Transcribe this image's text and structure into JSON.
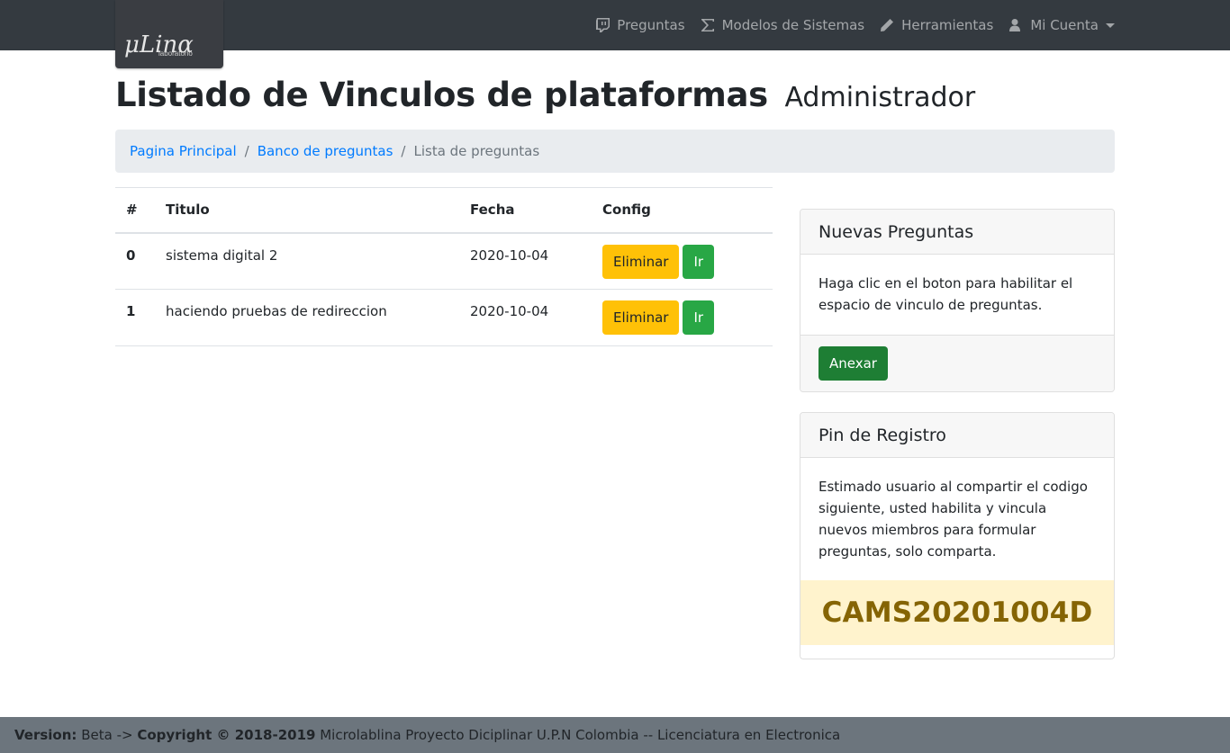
{
  "app": {
    "logo_text": "μLinα",
    "logo_subtext": "laboratorio"
  },
  "nav": {
    "items": [
      {
        "label": "Preguntas",
        "icon": "twitch-icon"
      },
      {
        "label": "Modelos de Sistemas",
        "icon": "sigma-icon"
      },
      {
        "label": "Herramientas",
        "icon": "pencil-icon"
      },
      {
        "label": "Mi Cuenta",
        "icon": "user-icon",
        "dropdown": true
      }
    ]
  },
  "page": {
    "title": "Listado de Vinculos de plataformas",
    "subtitle": "Administrador"
  },
  "breadcrumb": {
    "items": [
      "Pagina Principal",
      "Banco de preguntas"
    ],
    "active": "Lista de preguntas",
    "separator": "/"
  },
  "table": {
    "headers": [
      "#",
      "Titulo",
      "Fecha",
      "Config"
    ],
    "rows": [
      {
        "num": "0",
        "titulo": "sistema digital 2",
        "fecha": "2020-10-04",
        "delete_label": "Eliminar",
        "go_label": "Ir"
      },
      {
        "num": "1",
        "titulo": "haciendo pruebas de redireccion",
        "fecha": "2020-10-04",
        "delete_label": "Eliminar",
        "go_label": "Ir"
      }
    ]
  },
  "card_nuevas": {
    "header": "Nuevas Preguntas",
    "body": "Haga clic en el boton para habilitar el espacio de vinculo de preguntas.",
    "button": "Anexar"
  },
  "card_pin": {
    "header": "Pin de Registro",
    "body": "Estimado usuario al compartir el codigo siguiente, usted habilita y vincula nuevos miembros para formular preguntas, solo comparta.",
    "code": "CAMS20201004D"
  },
  "footer": {
    "version_label": "Version:",
    "version_text": "Beta ->",
    "copyright_label": "Copyright © 2018-2019",
    "copyright_text": "Microlablina Proyecto Diciplinar U.P.N Colombia -- Licenciatura en Electronica"
  },
  "colors": {
    "navbar": "#343a40",
    "link": "#007bff",
    "warning": "#ffc107",
    "success": "#28a745",
    "pin_bg": "#fff3cd",
    "pin_text": "#856404",
    "footer": "#6c757d"
  }
}
